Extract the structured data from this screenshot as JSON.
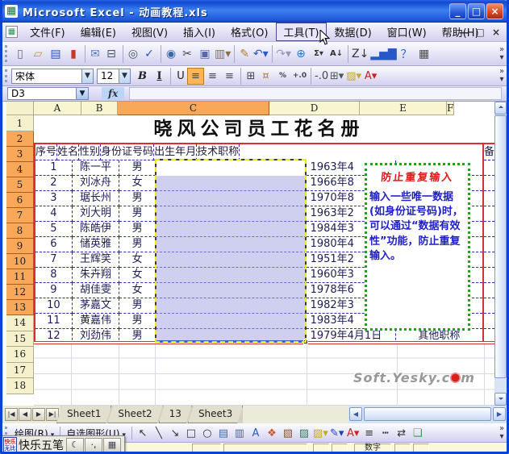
{
  "window": {
    "title": "Microsoft Excel - 动画教程.xls"
  },
  "title_controls": {
    "minimize": "_",
    "maximize": "□",
    "close": "×"
  },
  "menu_bar": {
    "items": [
      "文件(F)",
      "编辑(E)",
      "视图(V)",
      "插入(I)",
      "格式(O)",
      "工具(T)",
      "数据(D)",
      "窗口(W)",
      "帮助(H)"
    ],
    "active_item": "数据(D)",
    "doc_minimize": "—",
    "doc_restore": "□",
    "doc_close": "×"
  },
  "standard_toolbar": {
    "icons": [
      {
        "name": "new-icon",
        "glyph": "▯",
        "color": "#5a6a8a"
      },
      {
        "name": "open-icon",
        "glyph": "▱",
        "color": "#c89030"
      },
      {
        "name": "save-icon",
        "glyph": "▤",
        "color": "#3050b0"
      },
      {
        "name": "permission-icon",
        "glyph": "▮",
        "color": "#c03828"
      },
      {
        "name": "mail-icon",
        "glyph": "✉",
        "color": "#5878c0"
      },
      {
        "name": "print-icon",
        "glyph": "⊟",
        "color": "#4a5a6a"
      },
      {
        "name": "print-preview-icon",
        "glyph": "◎",
        "color": "#4a5a6a"
      },
      {
        "name": "spelling-icon",
        "glyph": "✓",
        "color": "#3050c0"
      },
      {
        "name": "research-icon",
        "glyph": "◉",
        "color": "#3868a8"
      },
      {
        "name": "cut-icon",
        "glyph": "✂",
        "color": "#444444"
      },
      {
        "name": "copy-icon",
        "glyph": "▣",
        "color": "#5868a8"
      },
      {
        "name": "paste-icon",
        "glyph": "▥▾",
        "color": "#8a7050"
      },
      {
        "name": "format-painter-icon",
        "glyph": "✎",
        "color": "#b08030"
      },
      {
        "name": "undo-icon",
        "glyph": "↶▾",
        "color": "#2858c8"
      },
      {
        "name": "redo-icon",
        "glyph": "↷▾",
        "color": "#9a9ab8"
      },
      {
        "name": "hyperlink-icon",
        "glyph": "⊕",
        "color": "#2878c8"
      },
      {
        "name": "autosum-icon",
        "glyph": "Σ▾",
        "color": "#333333"
      },
      {
        "name": "sort-ascending-icon",
        "glyph": "A↓",
        "color": "#333333"
      },
      {
        "name": "sort-descending-icon",
        "glyph": "Z↓",
        "color": "#333333"
      },
      {
        "name": "chart-wizard-icon",
        "glyph": "▂▅▇",
        "color": "#2858c8"
      },
      {
        "name": "help-icon",
        "glyph": "？",
        "color": "#2060d0"
      },
      {
        "name": "camera-icon",
        "glyph": "▦",
        "color": "#4a4a4a"
      }
    ]
  },
  "formatting_toolbar": {
    "font_name": "宋体",
    "font_size": "12",
    "buttons": [
      {
        "name": "bold-button",
        "glyph": "B",
        "color": "#222"
      },
      {
        "name": "italic-button",
        "glyph": "I",
        "color": "#222"
      },
      {
        "name": "underline-button",
        "glyph": "U",
        "color": "#222"
      },
      {
        "name": "align-left-button",
        "glyph": "≡",
        "color": "#445"
      },
      {
        "name": "align-center-button",
        "glyph": "≡",
        "color": "#445"
      },
      {
        "name": "align-right-button",
        "glyph": "≡",
        "color": "#445"
      },
      {
        "name": "merge-center-button",
        "glyph": "⊞",
        "color": "#445"
      },
      {
        "name": "currency-button",
        "glyph": "¤",
        "color": "#b08020"
      },
      {
        "name": "percent-button",
        "glyph": "%",
        "color": "#445"
      },
      {
        "name": "increase-decimal-button",
        "glyph": "+.0",
        "color": "#445"
      },
      {
        "name": "decrease-decimal-button",
        "glyph": "-.0",
        "color": "#445"
      },
      {
        "name": "borders-button",
        "glyph": "⊞▾",
        "color": "#555"
      },
      {
        "name": "fill-color-button",
        "glyph": "▨▾",
        "color": "#c8a820"
      },
      {
        "name": "font-color-button",
        "glyph": "A▾",
        "color": "#cc2020"
      }
    ]
  },
  "formula_bar": {
    "name_box": "D3",
    "fx_label": "fx",
    "formula_value": ""
  },
  "grid": {
    "column_headers": [
      "A",
      "B",
      "C",
      "D",
      "E",
      "F"
    ],
    "selected_column": "D",
    "row_numbers": [
      "1",
      "2",
      "3",
      "4",
      "5",
      "6",
      "7",
      "8",
      "9",
      "10",
      "11",
      "12",
      "13",
      "14",
      "15",
      "16",
      "17",
      "18"
    ],
    "sheet_title": "晓风公司员工花名册",
    "table_headers": [
      "序号",
      "姓名",
      "性别",
      "身份证号码",
      "出生年月",
      "技术职称"
    ],
    "overflow_header": "备",
    "rows": [
      {
        "no": "1",
        "name": "陈一平",
        "gender": "男",
        "id": "",
        "birth": "1963年4",
        "job": ""
      },
      {
        "no": "2",
        "name": "刘冰舟",
        "gender": "女",
        "id": "",
        "birth": "1966年8",
        "job": ""
      },
      {
        "no": "3",
        "name": "琚长州",
        "gender": "男",
        "id": "",
        "birth": "1970年8",
        "job": ""
      },
      {
        "no": "4",
        "name": "刘大明",
        "gender": "男",
        "id": "",
        "birth": "1963年2",
        "job": ""
      },
      {
        "no": "5",
        "name": "陈皓伊",
        "gender": "男",
        "id": "",
        "birth": "1984年3",
        "job": ""
      },
      {
        "no": "6",
        "name": "储英雅",
        "gender": "男",
        "id": "",
        "birth": "1980年4",
        "job": ""
      },
      {
        "no": "7",
        "name": "王辉笑",
        "gender": "女",
        "id": "",
        "birth": "1951年2",
        "job": ""
      },
      {
        "no": "8",
        "name": "朱卉翔",
        "gender": "女",
        "id": "",
        "birth": "1960年3",
        "job": ""
      },
      {
        "no": "9",
        "name": "胡佳雯",
        "gender": "女",
        "id": "",
        "birth": "1978年6",
        "job": ""
      },
      {
        "no": "10",
        "name": "茅嘉文",
        "gender": "男",
        "id": "",
        "birth": "1982年3",
        "job": ""
      },
      {
        "no": "11",
        "name": "黄嘉伟",
        "gender": "男",
        "id": "",
        "birth": "1983年4",
        "job": ""
      },
      {
        "no": "12",
        "name": "刘劲伟",
        "gender": "男",
        "id": "",
        "birth": "1979年4月1日",
        "job": "其他职称"
      }
    ]
  },
  "note_box": {
    "title": "防止重复输入",
    "body": "输入一些唯一数据(如身份证号码)时，可以通过“数据有效性”功能，防止重复输入。"
  },
  "watermark": {
    "prefix": "Soft.Yesky.c",
    "suffix": "m"
  },
  "sheet_tab_bar": {
    "nav": [
      {
        "name": "first-sheet-button",
        "glyph": "|◀"
      },
      {
        "name": "prev-sheet-button",
        "glyph": "◀"
      },
      {
        "name": "next-sheet-button",
        "glyph": "▶"
      },
      {
        "name": "last-sheet-button",
        "glyph": "▶|"
      }
    ],
    "tabs": [
      "Sheet1",
      "Sheet2",
      "13",
      "Sheet3"
    ],
    "active_tab": "Sheet1"
  },
  "drawing_toolbar": {
    "draw_label": "绘图(R)",
    "autoshapes_label": "自选图形(U)",
    "icons": [
      {
        "name": "select-arrow-icon",
        "glyph": "↖",
        "color": "#333"
      },
      {
        "name": "line-icon",
        "glyph": "╲",
        "color": "#333"
      },
      {
        "name": "arrow-icon",
        "glyph": "↘",
        "color": "#333"
      },
      {
        "name": "rectangle-icon",
        "glyph": "□",
        "color": "#333"
      },
      {
        "name": "oval-icon",
        "glyph": "○",
        "color": "#333"
      },
      {
        "name": "textbox-icon",
        "glyph": "▤",
        "color": "#4a6a9a"
      },
      {
        "name": "vertical-textbox-icon",
        "glyph": "▥",
        "color": "#4a6a9a"
      },
      {
        "name": "wordart-icon",
        "glyph": "A",
        "color": "#2858c8"
      },
      {
        "name": "diagram-icon",
        "glyph": "❖",
        "color": "#c85830"
      },
      {
        "name": "clipart-icon",
        "glyph": "▧",
        "color": "#8a5828"
      },
      {
        "name": "picture-icon",
        "glyph": "▨",
        "color": "#38785a"
      },
      {
        "name": "fill-color-icon",
        "glyph": "▨▾",
        "color": "#c8a820"
      },
      {
        "name": "line-color-icon",
        "glyph": "✎▾",
        "color": "#2040c0"
      },
      {
        "name": "font-color-icon",
        "glyph": "A▾",
        "color": "#d02020"
      },
      {
        "name": "line-style-icon",
        "glyph": "≡",
        "color": "#333"
      },
      {
        "name": "dash-style-icon",
        "glyph": "┅",
        "color": "#333"
      },
      {
        "name": "arrow-style-icon",
        "glyph": "⇄",
        "color": "#333"
      },
      {
        "name": "shadow-style-icon",
        "glyph": "❏",
        "color": "#3a9a4a"
      }
    ]
  },
  "ime_bar": {
    "logo_top": "快乐",
    "logo_bottom": "无比",
    "name": "快乐五笔",
    "buttons": [
      {
        "name": "moon-icon",
        "glyph": "☾",
        "color": "#222"
      },
      {
        "name": "punctuation-icon",
        "glyph": "·,",
        "color": "#222"
      },
      {
        "name": "keyboard-icon",
        "glyph": "▦",
        "color": "#445"
      }
    ]
  },
  "status_bar": {
    "num_label": "数字"
  }
}
